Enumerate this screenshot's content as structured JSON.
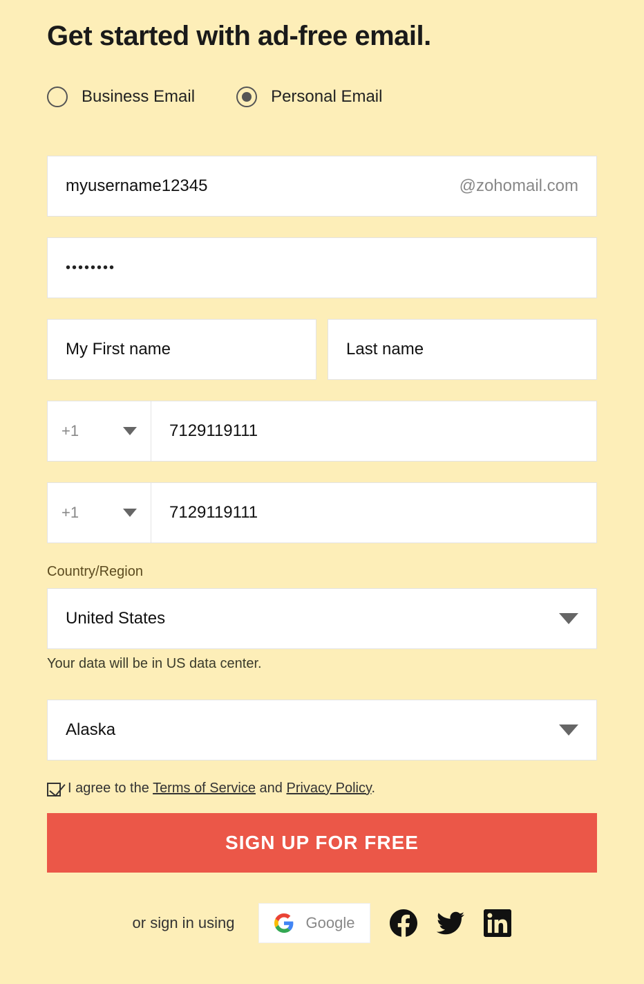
{
  "title": "Get started with ad-free email.",
  "email_type": {
    "options": [
      "Business Email",
      "Personal Email"
    ],
    "selected": "Personal Email"
  },
  "username": {
    "value": "myusername12345",
    "domain_suffix": "@zohomail.com"
  },
  "password_mask": "••••••••",
  "first_name": "My First name",
  "last_name": "Last name",
  "phone1": {
    "prefix": "+1",
    "value": "7129119111"
  },
  "phone2": {
    "prefix": "+1",
    "value": "7129119111"
  },
  "country": {
    "label": "Country/Region",
    "value": "United States",
    "hint": "Your data will be in US data center."
  },
  "state": {
    "value": "Alaska"
  },
  "agreement": {
    "checked": true,
    "prefix": "I agree to the ",
    "tos": "Terms of Service",
    "mid": " and ",
    "privacy": "Privacy Policy",
    "suffix": "."
  },
  "signup_button": "SIGN UP FOR FREE",
  "social": {
    "lead": "or sign in using",
    "google_label": "Google"
  }
}
